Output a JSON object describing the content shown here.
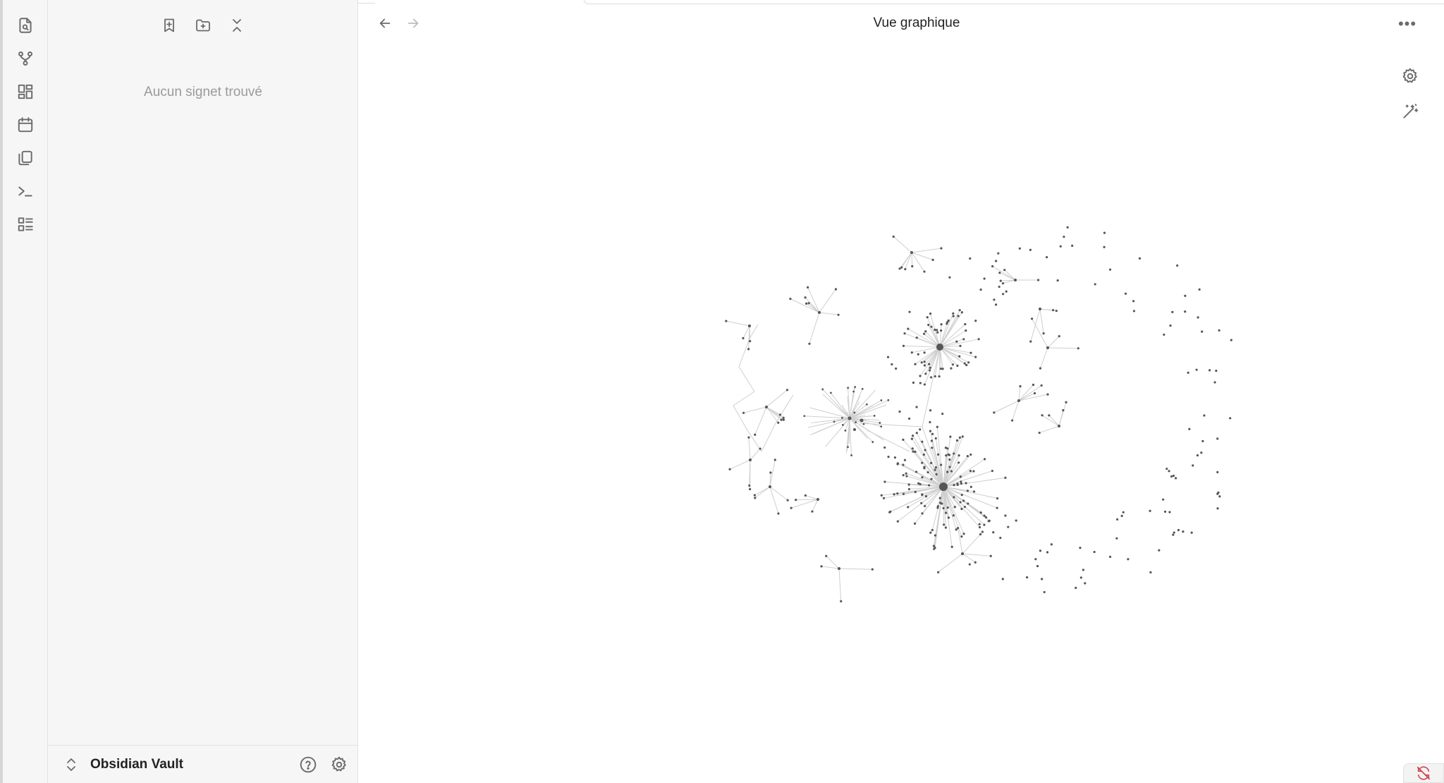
{
  "ribbon": {
    "items": [
      {
        "icon": "file-search-icon"
      },
      {
        "icon": "graph-fork-icon"
      },
      {
        "icon": "dashboard-grid-icon"
      },
      {
        "icon": "calendar-icon"
      },
      {
        "icon": "copy-files-icon"
      },
      {
        "icon": "terminal-icon"
      },
      {
        "icon": "list-details-icon"
      }
    ]
  },
  "bookmarks": {
    "actions": [
      "add-bookmark-icon",
      "new-folder-icon",
      "collapse-all-icon"
    ],
    "empty_message": "Aucun signet trouvé"
  },
  "vault": {
    "name": "Obsidian Vault",
    "help_icon": "help-circle-icon",
    "settings_icon": "settings-gear-icon"
  },
  "view": {
    "title": "Vue graphique",
    "back_icon": "arrow-left-icon",
    "forward_icon": "arrow-right-icon",
    "more_icon": "more-horizontal-icon",
    "graph_settings_icon": "gear-icon",
    "animate_icon": "magic-wand-icon"
  },
  "status": {
    "sync_icon": "sync-off-icon",
    "sync_color": "#d0454c"
  },
  "colors": {
    "node": "#555555",
    "edge": "#cfcfcf",
    "sidebar_bg": "#f6f6f6"
  }
}
